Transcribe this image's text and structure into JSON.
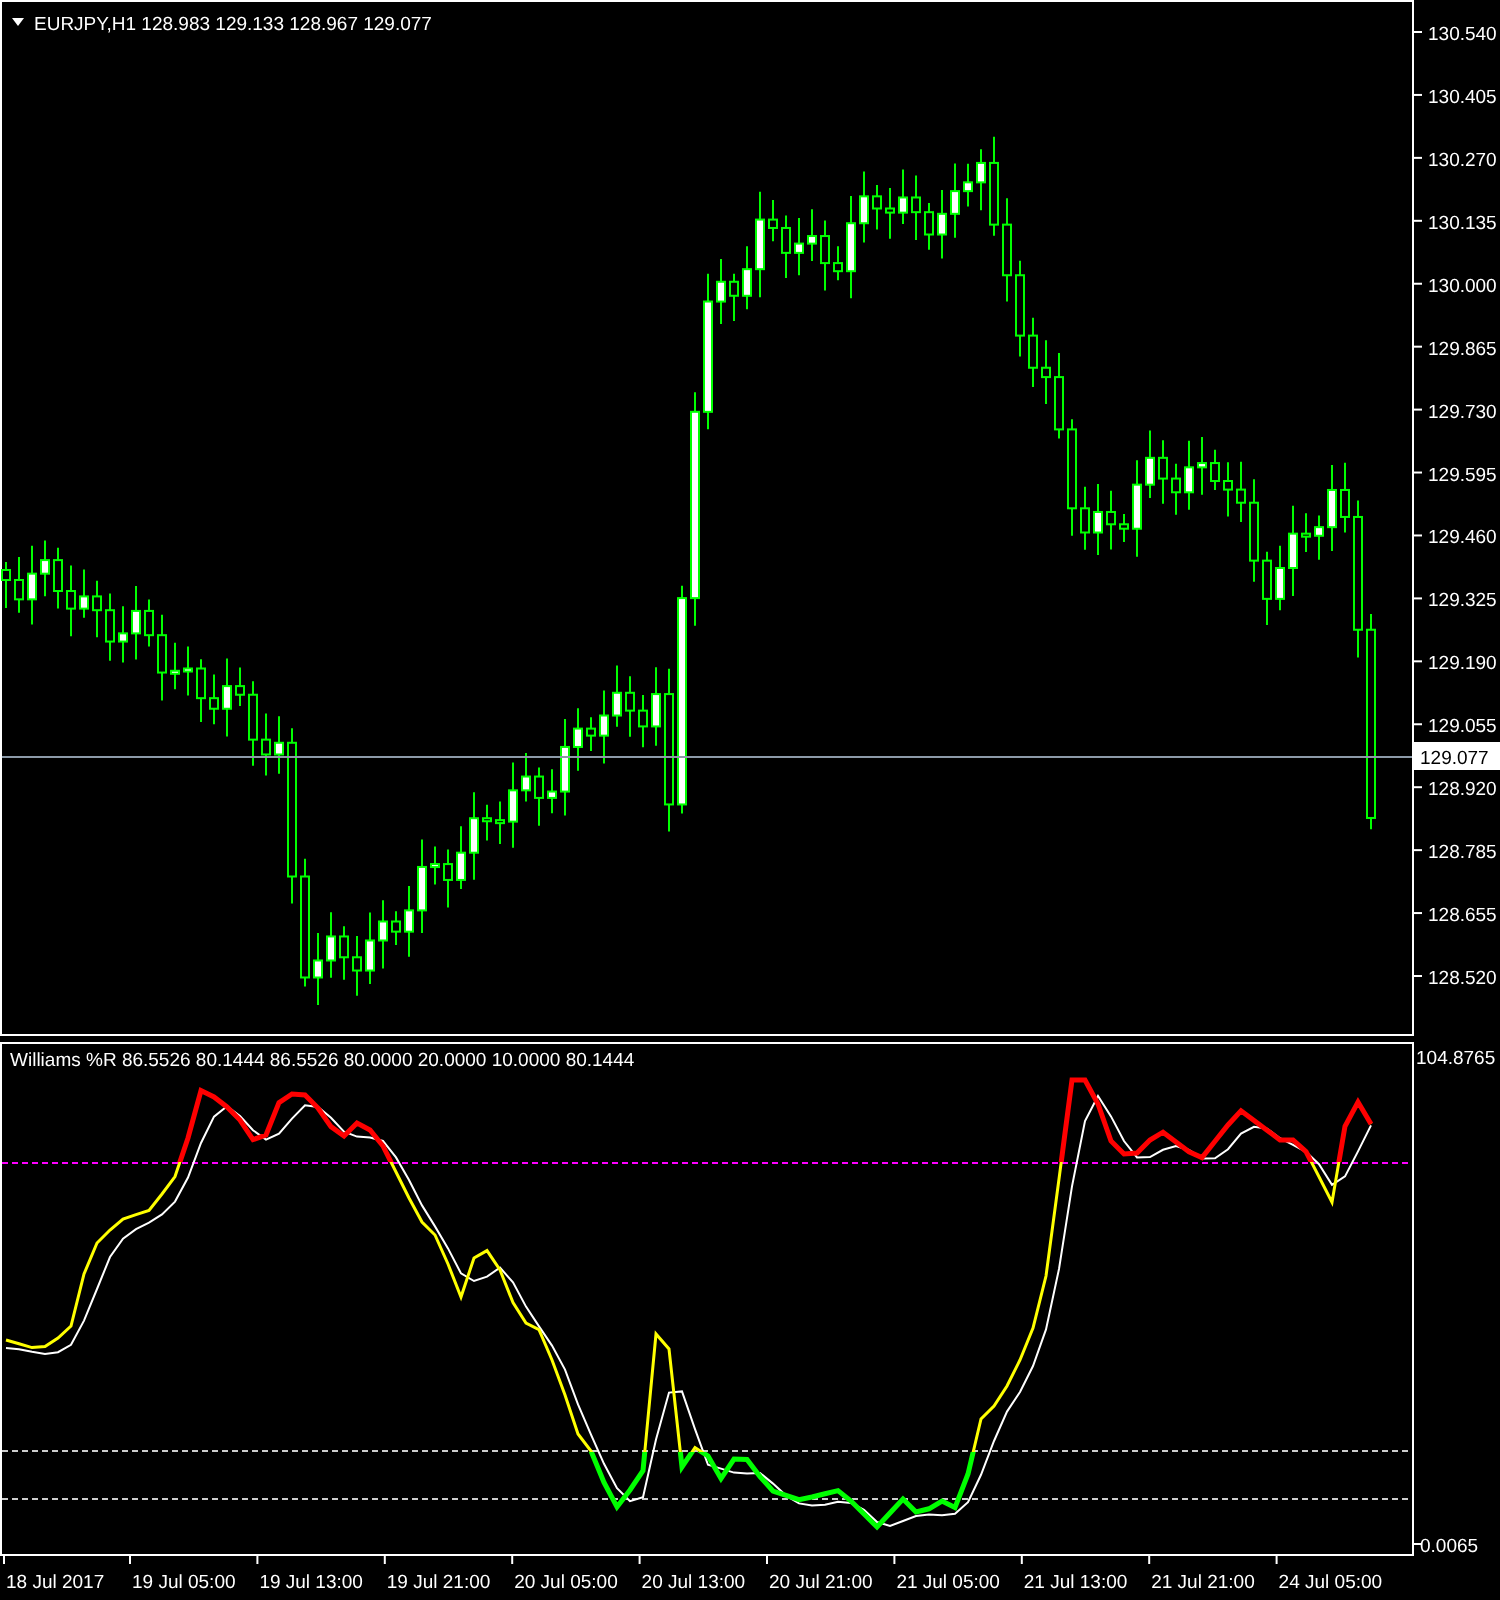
{
  "chart_window": {
    "header": "EURJPY,H1  128.983 129.133 128.967 129.077",
    "price_axis": [
      "130.540",
      "130.405",
      "130.270",
      "130.135",
      "130.000",
      "129.865",
      "129.730",
      "129.595",
      "129.460",
      "129.325",
      "129.190",
      "129.055",
      "128.920",
      "128.785",
      "128.655",
      "128.520"
    ],
    "current_price": "129.077",
    "indicator": {
      "header": "Williams %R 86.5526 80.1444 86.5526 80.0000 20.0000 10.0000 80.1444",
      "axis": [
        "104.8765",
        "0.0065"
      ]
    },
    "time_axis": [
      "18 Jul 2017",
      "19 Jul 05:00",
      "19 Jul 13:00",
      "19 Jul 21:00",
      "20 Jul 05:00",
      "20 Jul 13:00",
      "20 Jul 21:00",
      "21 Jul 05:00",
      "21 Jul 13:00",
      "21 Jul 21:00",
      "24 Jul 05:00"
    ]
  }
}
